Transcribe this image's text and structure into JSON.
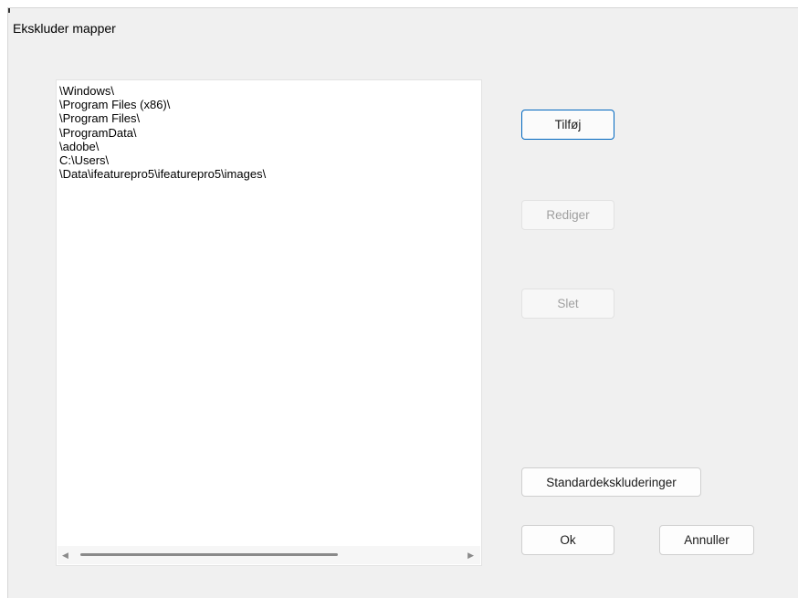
{
  "dialog": {
    "title": "Ekskluder mapper"
  },
  "excluded_folders": {
    "items": [
      "\\Windows\\",
      "\\Program Files (x86)\\",
      "\\Program Files\\",
      "\\ProgramData\\",
      "\\adobe\\",
      "C:\\Users\\",
      "\\Data\\ifeaturepro5\\ifeaturepro5\\images\\"
    ]
  },
  "buttons": {
    "add_label": "Tilføj",
    "edit_label": "Rediger",
    "delete_label": "Slet",
    "defaults_label": "Standardekskluderinger",
    "ok_label": "Ok",
    "cancel_label": "Annuller"
  },
  "icons": {
    "scroll_left": "triangle-left-icon",
    "scroll_right": "triangle-right-icon"
  },
  "colors": {
    "accent_border": "#0067c0",
    "dialog_background": "#f0f0f0"
  }
}
